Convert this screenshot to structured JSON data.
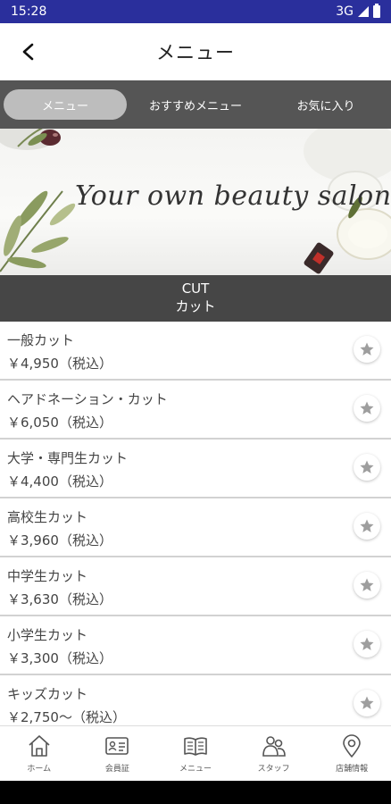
{
  "status_bar": {
    "time": "15:28",
    "network": "3G"
  },
  "header": {
    "title": "メニュー"
  },
  "tabs": [
    {
      "label": "メニュー",
      "active": true
    },
    {
      "label": "おすすめメニュー",
      "active": false
    },
    {
      "label": "お気に入り",
      "active": false
    }
  ],
  "banner": {
    "text": "Your own beauty salon"
  },
  "section": {
    "title_en": "CUT",
    "title_ja": "カット"
  },
  "menu_items": [
    {
      "name": "一般カット",
      "price": "￥4,950（税込）"
    },
    {
      "name": "ヘアドネーション・カット",
      "price": "￥6,050（税込）"
    },
    {
      "name": "大学・専門生カット",
      "price": "￥4,400（税込）"
    },
    {
      "name": "高校生カット",
      "price": "￥3,960（税込）"
    },
    {
      "name": "中学生カット",
      "price": "￥3,630（税込）"
    },
    {
      "name": "小学生カット",
      "price": "￥3,300（税込）"
    },
    {
      "name": "キッズカット",
      "price": "￥2,750～（税込）"
    }
  ],
  "bottom_nav": [
    {
      "label": "ホーム",
      "icon": "home-icon"
    },
    {
      "label": "会員証",
      "icon": "member-card-icon"
    },
    {
      "label": "メニュー",
      "icon": "book-icon"
    },
    {
      "label": "スタッフ",
      "icon": "staff-icon"
    },
    {
      "label": "店舗情報",
      "icon": "location-pin-icon"
    }
  ],
  "colors": {
    "status_bar": "#2a2f9c",
    "tab_bar": "#555555",
    "section_header": "#464646",
    "star": "#9e9e9e"
  }
}
